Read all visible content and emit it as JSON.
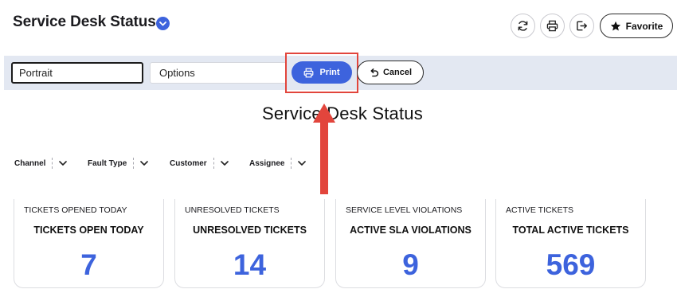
{
  "header": {
    "title": "Service Desk Status",
    "favorite_label": "Favorite",
    "icons": [
      "chevron-down-icon",
      "refresh-icon",
      "print-icon",
      "export-icon",
      "star-icon"
    ]
  },
  "print_bar": {
    "orientation_value": "Portrait",
    "options_value": "Options",
    "print_label": "Print",
    "cancel_label": "Cancel"
  },
  "report": {
    "title": "Service Desk Status",
    "filters": [
      {
        "label": "Channel"
      },
      {
        "label": "Fault Type"
      },
      {
        "label": "Customer"
      },
      {
        "label": "Assignee"
      }
    ],
    "cards": [
      {
        "caption": "TICKETS OPENED TODAY",
        "heading": "TICKETS OPEN TODAY",
        "value": "7"
      },
      {
        "caption": "UNRESOLVED TICKETS",
        "heading": "UNRESOLVED TICKETS",
        "value": "14"
      },
      {
        "caption": "SERVICE LEVEL VIOLATIONS",
        "heading": "ACTIVE SLA VIOLATIONS",
        "value": "9"
      },
      {
        "caption": "ACTIVE TICKETS",
        "heading": "TOTAL ACTIVE TICKETS",
        "value": "569"
      }
    ]
  },
  "colors": {
    "accent": "#3d63dd",
    "annotation": "#e2453c",
    "print_bar_bg": "#e3e8f2"
  }
}
